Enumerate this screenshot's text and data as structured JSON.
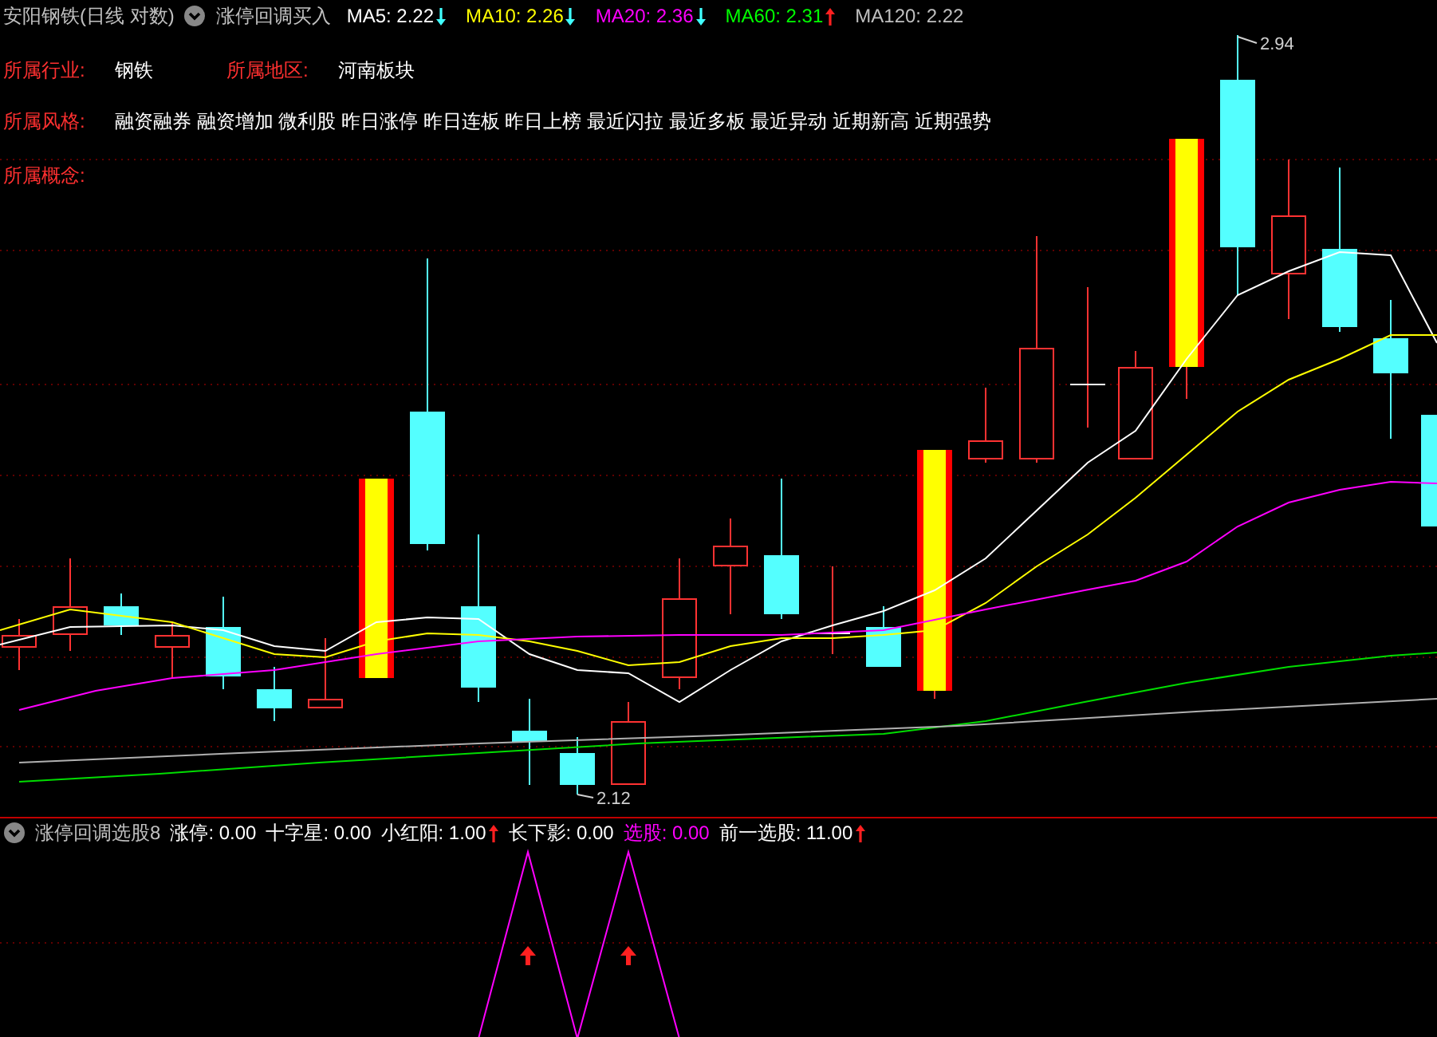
{
  "header": {
    "stock_title": "安阳钢铁(日线 对数)",
    "formula_name": "涨停回调买入",
    "ma": [
      {
        "label": "MA5: 2.22",
        "rising": false,
        "color": "#ffffff"
      },
      {
        "label": "MA10: 2.26",
        "rising": false,
        "color": "#ffff00"
      },
      {
        "label": "MA20: 2.36",
        "rising": false,
        "color": "#ff00ff"
      },
      {
        "label": "MA60: 2.31",
        "rising": true,
        "color": "#00ff00"
      },
      {
        "label": "MA120: 2.22",
        "color": "#c0c0c0"
      }
    ]
  },
  "info": {
    "industry": {
      "label": "所属行业:",
      "value": "钢铁"
    },
    "region": {
      "label": "所属地区:",
      "value": "河南板块"
    },
    "style": {
      "label": "所属风格:",
      "value": "融资融券 融资增加 微利股 昨日涨停 昨日连板 昨日上榜 最近闪拉 最近多板 最近异动 近期新高 近期强势"
    },
    "concept": {
      "label": "所属概念:"
    }
  },
  "price_labels": {
    "high": "2.94",
    "low": "2.12"
  },
  "indicator": {
    "name": "涨停回调选股8",
    "values": [
      {
        "label": "涨停: 0.00",
        "color": "#ffffff"
      },
      {
        "label": "十字星: 0.00",
        "color": "#ffffff"
      },
      {
        "label": "小红阳: 1.00",
        "rising": true,
        "color": "#ffffff"
      },
      {
        "label": "长下影: 0.00",
        "color": "#ffffff"
      },
      {
        "label": "选股: 0.00",
        "color": "#ff00ff"
      },
      {
        "label": "前一选股: 11.00",
        "rising": true,
        "color": "#ffffff"
      }
    ]
  }
}
